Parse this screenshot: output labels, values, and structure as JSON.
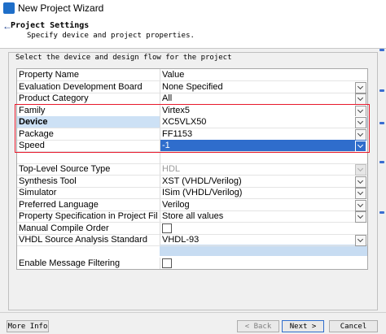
{
  "window": {
    "title": "New Project Wizard"
  },
  "header": {
    "title": "Project Settings",
    "subtitle": "Specify device and project properties."
  },
  "group": {
    "label": "Select the device and design flow for the project"
  },
  "grid": {
    "header": {
      "name": "Property Name",
      "value": "Value"
    },
    "rows": [
      {
        "name": "Evaluation Development Board",
        "value": "None Specified"
      },
      {
        "name": "Product Category",
        "value": "All"
      },
      {
        "name": "Family",
        "value": "Virtex5"
      },
      {
        "name": "Device",
        "value": "XC5VLX50"
      },
      {
        "name": "Package",
        "value": "FF1153"
      },
      {
        "name": "Speed",
        "value": "-1"
      },
      {
        "name": "",
        "value": ""
      },
      {
        "name": "Top-Level Source Type",
        "value": "HDL"
      },
      {
        "name": "Synthesis Tool",
        "value": "XST (VHDL/Verilog)"
      },
      {
        "name": "Simulator",
        "value": "ISim (VHDL/Verilog)"
      },
      {
        "name": "Preferred Language",
        "value": "Verilog"
      },
      {
        "name": "Property Specification in Project File",
        "value": "Store all values"
      },
      {
        "name": "Manual Compile Order",
        "value": ""
      },
      {
        "name": "VHDL Source Analysis Standard",
        "value": "VHDL-93"
      },
      {
        "name": "",
        "value": ""
      },
      {
        "name": "Enable Message Filtering",
        "value": ""
      }
    ]
  },
  "buttons": {
    "more_info": "More Info",
    "back": "< Back",
    "next": "Next >",
    "cancel": "Cancel"
  },
  "colors": {
    "selection": "#2f6dcc",
    "device_row": "#cde1f5",
    "highlight_box": "#e8192c"
  }
}
